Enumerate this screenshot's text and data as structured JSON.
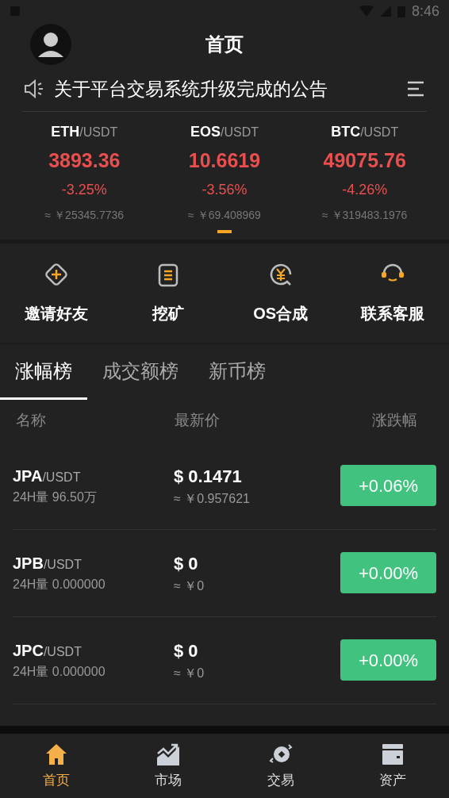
{
  "status_bar": {
    "time": "8:46"
  },
  "header": {
    "title": "首页"
  },
  "notice": {
    "text": "关于平台交易系统升级完成的公告"
  },
  "tickers": [
    {
      "base": "ETH",
      "quote": "/USDT",
      "price": "3893.36",
      "change": "-3.25%",
      "cny": "≈ ￥25345.7736"
    },
    {
      "base": "EOS",
      "quote": "/USDT",
      "price": "10.6619",
      "change": "-3.56%",
      "cny": "≈ ￥69.408969"
    },
    {
      "base": "BTC",
      "quote": "/USDT",
      "price": "49075.76",
      "change": "-4.26%",
      "cny": "≈ ￥319483.1976"
    }
  ],
  "shortcuts": [
    {
      "kind": "invite",
      "label": "邀请好友"
    },
    {
      "kind": "mining",
      "label": "挖矿"
    },
    {
      "kind": "exchange",
      "label": "OS合成"
    },
    {
      "kind": "support",
      "label": "联系客服"
    }
  ],
  "tabs": [
    {
      "label": "涨幅榜",
      "selected": true
    },
    {
      "label": "成交额榜",
      "selected": false
    },
    {
      "label": "新币榜",
      "selected": false
    }
  ],
  "table": {
    "columns": [
      "名称",
      "最新价",
      "涨跌幅"
    ],
    "rows": [
      {
        "base": "JPA",
        "quote": "/USDT",
        "volume_label": "24H量",
        "volume": "96.50万",
        "price": "$ 0.1471",
        "cny": "≈ ￥0.957621",
        "change": "+0.06%"
      },
      {
        "base": "JPB",
        "quote": "/USDT",
        "volume_label": "24H量",
        "volume": "0.000000",
        "price": "$ 0",
        "cny": "≈ ￥0",
        "change": "+0.00%"
      },
      {
        "base": "JPC",
        "quote": "/USDT",
        "volume_label": "24H量",
        "volume": "0.000000",
        "price": "$ 0",
        "cny": "≈ ￥0",
        "change": "+0.00%"
      }
    ]
  },
  "nav": [
    {
      "kind": "home",
      "label": "首页",
      "selected": true
    },
    {
      "kind": "market",
      "label": "市场",
      "selected": false
    },
    {
      "kind": "trade",
      "label": "交易",
      "selected": false
    },
    {
      "kind": "assets",
      "label": "资产",
      "selected": false
    }
  ]
}
